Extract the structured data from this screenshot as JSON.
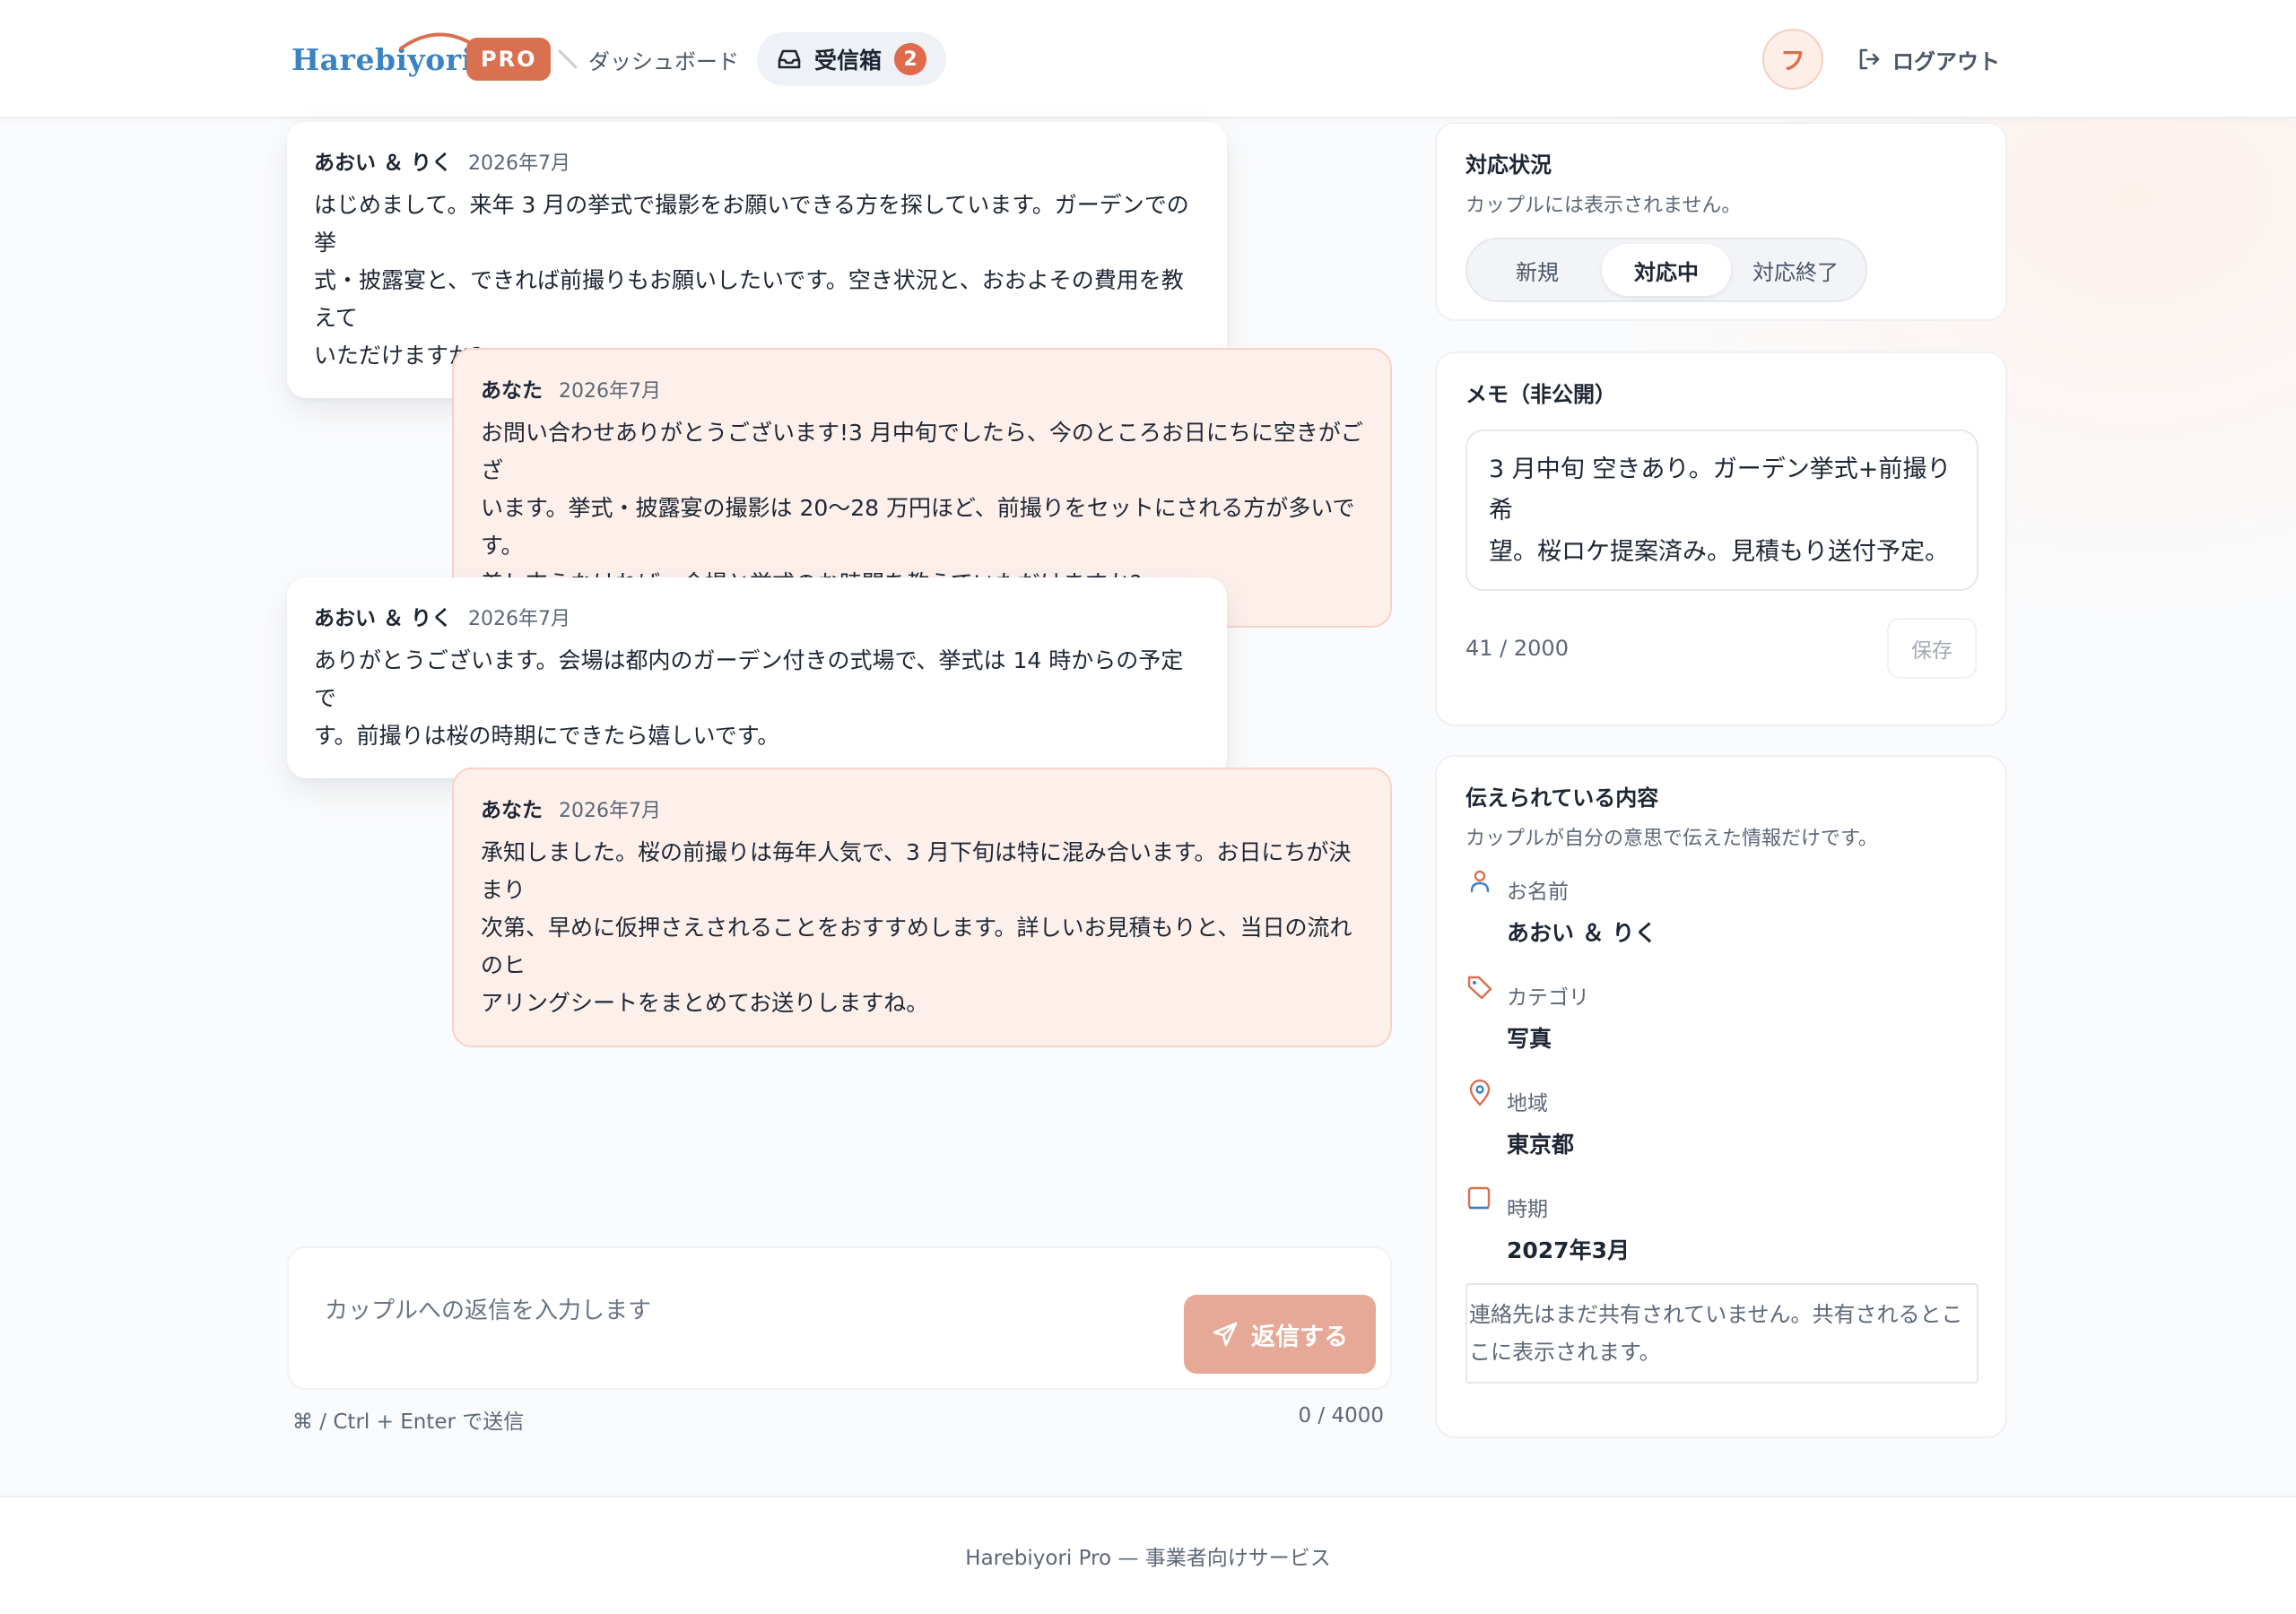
{
  "header": {
    "logo_text": "Harebiyori",
    "pro_badge": "PRO",
    "nav_dashboard": "ダッシュボード",
    "nav_inbox": "受信箱",
    "inbox_count": "2",
    "avatar_initial": "フ",
    "logout_label": "ログアウト",
    "brand_color": "#3b82c4",
    "accent_color": "#d9704f"
  },
  "messages": [
    {
      "sender": "あおい ＆ りく",
      "date": "2026年7月",
      "from": "them",
      "lines": [
        "はじめまして。来年 3 月の挙式で撮影をお願いできる方を探しています。ガーデンでの挙",
        "式・披露宴と、できれば前撮りもお願いしたいです。空き状況と、おおよその費用を教えて",
        "いただけますか?"
      ]
    },
    {
      "sender": "あなた",
      "date": "2026年7月",
      "from": "me",
      "lines": [
        "お問い合わせありがとうございます!3 月中旬でしたら、今のところお日にちに空きがござ",
        "います。挙式・披露宴の撮影は 20〜28 万円ほど、前撮りをセットにされる方が多いです。",
        "差し支えなければ、会場と挙式のお時間を教えていただけますか?"
      ]
    },
    {
      "sender": "あおい ＆ りく",
      "date": "2026年7月",
      "from": "them",
      "lines": [
        "ありがとうございます。会場は都内のガーデン付きの式場で、挙式は 14 時からの予定で",
        "す。前撮りは桜の時期にできたら嬉しいです。"
      ]
    },
    {
      "sender": "あなた",
      "date": "2026年7月",
      "from": "me",
      "lines": [
        "承知しました。桜の前撮りは毎年人気で、3 月下旬は特に混み合います。お日にちが決まり",
        "次第、早めに仮押さえされることをおすすめします。詳しいお見積もりと、当日の流れのヒ",
        "アリングシートをまとめてお送りしますね。"
      ]
    }
  ],
  "composer": {
    "placeholder": "カップルへの返信を入力します",
    "send_label": "返信する",
    "hint": "⌘ / Ctrl + Enter で送信",
    "counter": "0 / 4000"
  },
  "status": {
    "title": "対応状況",
    "subtitle": "カップルには表示されません。",
    "options": [
      "新規",
      "対応中",
      "対応終了"
    ],
    "selected": "対応中"
  },
  "memo": {
    "title": "メモ（非公開）",
    "lines": [
      "3 月中旬 空きあり。ガーデン挙式+前撮り希",
      "望。桜ロケ提案済み。見積もり送付予定。"
    ],
    "count": "41 / 2000",
    "save_label": "保存"
  },
  "info": {
    "title": "伝えられている内容",
    "subtitle": "カップルが自分の意思で伝えた情報だけです。",
    "items": [
      {
        "icon": "person-icon",
        "label": "お名前",
        "value": "あおい ＆ りく"
      },
      {
        "icon": "tag-icon",
        "label": "カテゴリ",
        "value": "写真"
      },
      {
        "icon": "map-pin-icon",
        "label": "地域",
        "value": "東京都"
      },
      {
        "icon": "calendar-icon",
        "label": "時期",
        "value": "2027年3月"
      }
    ],
    "contact_note_lines": [
      "連絡先はまだ共有されていません。共有されるとこ",
      "こに表示されます。"
    ]
  },
  "footer": {
    "text": "Harebiyori Pro — 事業者向けサービス"
  }
}
